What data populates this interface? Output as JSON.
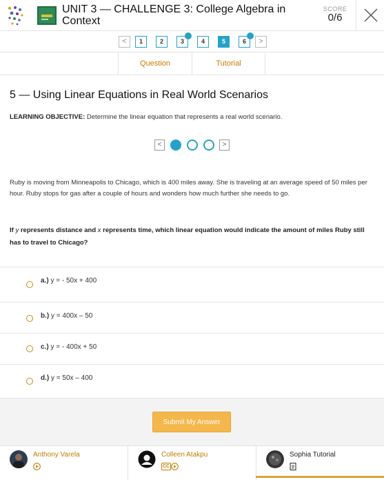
{
  "header": {
    "title": "UNIT 3 — CHALLENGE 3: College Algebra in Context",
    "score_label": "SCORE",
    "score_value": "0/6"
  },
  "pager": {
    "prev": "<",
    "next": ">",
    "pages": [
      {
        "label": "1",
        "state": "default",
        "marked": false
      },
      {
        "label": "2",
        "state": "default",
        "marked": false
      },
      {
        "label": "3",
        "state": "default",
        "marked": true
      },
      {
        "label": "4",
        "state": "default",
        "marked": false
      },
      {
        "label": "5",
        "state": "active",
        "marked": false
      },
      {
        "label": "6",
        "state": "default",
        "marked": true
      }
    ]
  },
  "tabs": [
    "Question",
    "Tutorial"
  ],
  "main": {
    "heading": "5 — Using Linear Equations in Real World Scenarios",
    "objective_label": "LEARNING OBJECTIVE:",
    "objective_text": "Determine the linear equation that represents a real world scenario.",
    "stepper": {
      "prev": "<",
      "next": ">",
      "steps": 3,
      "current": 1
    },
    "paragraph": "Ruby is moving from Minneapolis to Chicago, which is 400 miles away.  She is traveling at an average speed of 50 miles per hour. Ruby stops for gas after a couple of hours and wonders how much further she needs to go.",
    "question": {
      "p1": "If ",
      "var_y": "y",
      "p2": " represents distance and ",
      "var_x": "x",
      "p3": " represents time, which linear equation would indicate the amount of miles Ruby still has to travel to Chicago?"
    },
    "options": [
      {
        "label": "a.)",
        "equation": "y = - 50x + 400"
      },
      {
        "label": "b.)",
        "equation": "y = 400x – 50"
      },
      {
        "label": "c.)",
        "equation": "y = - 400x + 50"
      },
      {
        "label": "d.)",
        "equation": "y = 50x – 400"
      }
    ],
    "submit_label": "Submit My Answer"
  },
  "tutors": [
    {
      "name": "Anthony Varela",
      "icons": [
        "play-icon"
      ]
    },
    {
      "name": "Colleen Atakpu",
      "icons": [
        "cc-icon",
        "play-icon"
      ],
      "cc": "CC"
    },
    {
      "name": "Sophia Tutorial",
      "icons": [
        "document-icon"
      ]
    }
  ],
  "colors": {
    "accent": "#23a3c9",
    "link": "#c47d00",
    "submit": "#f4b74b",
    "radio": "#c98a14"
  }
}
